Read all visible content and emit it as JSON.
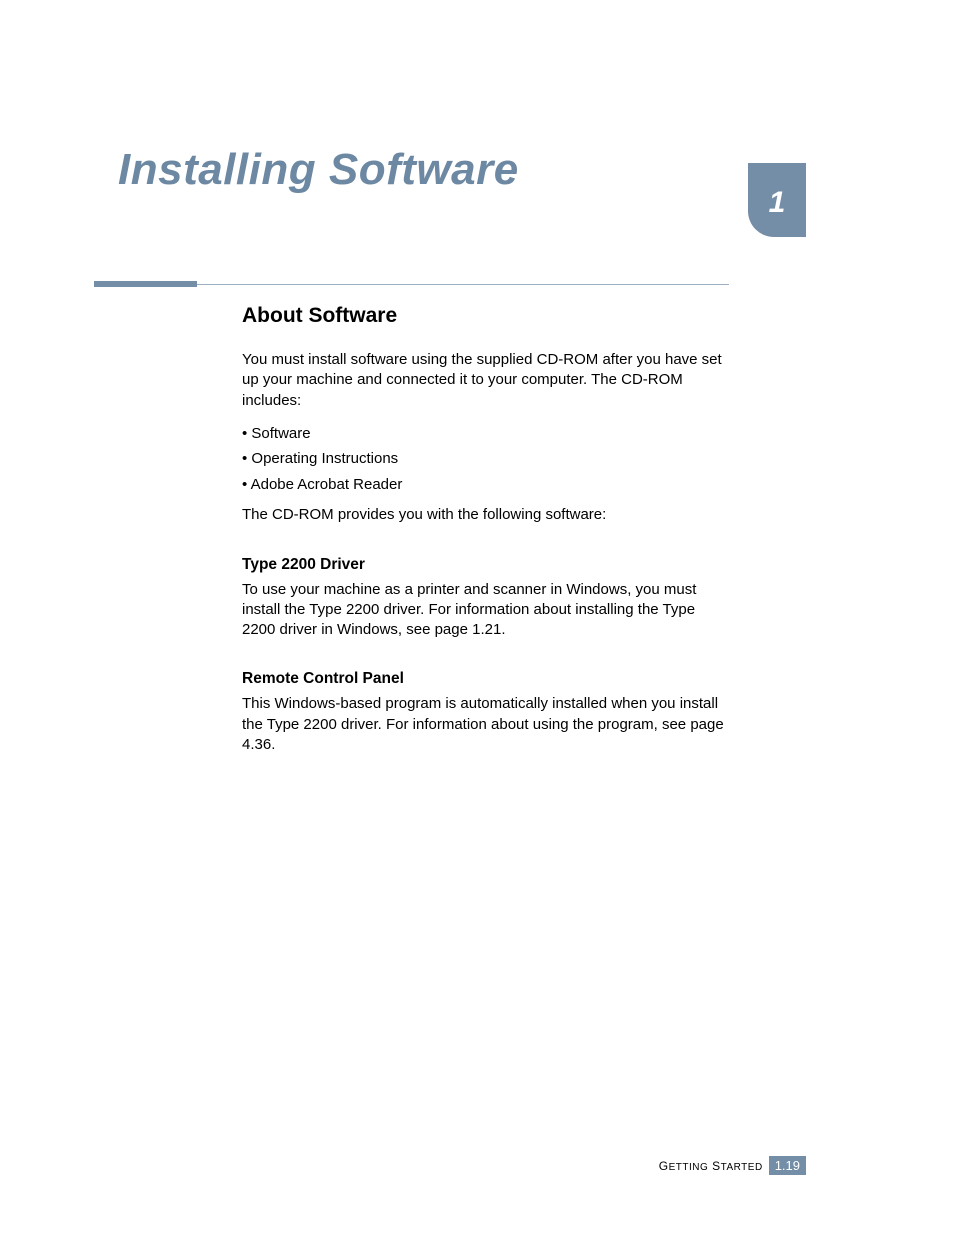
{
  "page": {
    "title": "Installing Software",
    "chapter_number": "1"
  },
  "section": {
    "heading": "About Software",
    "intro": "You must install software using the supplied CD-ROM after you have set up your machine and connected it to your computer. The CD-ROM includes:",
    "bullets": [
      "• Software",
      "• Operating Instructions",
      "• Adobe Acrobat Reader"
    ],
    "after_bullets": "The CD-ROM provides you with the following software:",
    "subsections": [
      {
        "heading": "Type 2200 Driver",
        "body": "To use your machine as a printer and scanner in Windows, you must install the Type 2200 driver. For information about installing the Type 2200 driver in Windows, see page 1.21."
      },
      {
        "heading": "Remote Control Panel",
        "body": "This Windows-based program is automatically installed when you install the Type 2200 driver. For information about using the program, see page 4.36."
      }
    ]
  },
  "footer": {
    "label_pre": "G",
    "label_mid1": "ETTING",
    "label_sp": " S",
    "label_mid2": "TARTED",
    "page_number": "1.19"
  }
}
